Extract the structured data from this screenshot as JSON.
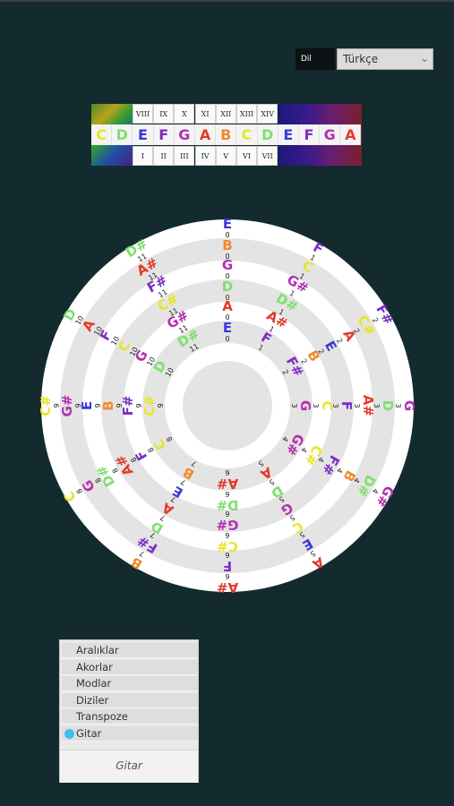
{
  "language": {
    "label": "Dil",
    "selected": "Türkçe"
  },
  "strip": {
    "top_numerals": [
      "VIII",
      "IX",
      "X",
      "XI",
      "XII",
      "XIII",
      "XIV"
    ],
    "bottom_numerals": [
      "I",
      "II",
      "III",
      "IV",
      "V",
      "VI",
      "VII"
    ],
    "notes": [
      {
        "name": "C",
        "color": "#e6e62a"
      },
      {
        "name": "D",
        "color": "#7ee06e"
      },
      {
        "name": "E",
        "color": "#3a3ad6"
      },
      {
        "name": "F",
        "color": "#7b2fc2"
      },
      {
        "name": "G",
        "color": "#b32fb0"
      },
      {
        "name": "A",
        "color": "#e23a2a"
      },
      {
        "name": "B",
        "color": "#f08a2a"
      },
      {
        "name": "C",
        "color": "#e6e62a"
      },
      {
        "name": "D",
        "color": "#7ee06e"
      },
      {
        "name": "E",
        "color": "#3a3ad6"
      },
      {
        "name": "F",
        "color": "#7b2fc2"
      },
      {
        "name": "G",
        "color": "#b32fb0"
      },
      {
        "name": "A",
        "color": "#e23a2a"
      }
    ]
  },
  "wheel": {
    "colors": {
      "C": "#e6e62a",
      "D": "#7ee06e",
      "E": "#3a3ad6",
      "F": "#7b2fc2",
      "G": "#b32fb0",
      "A": "#e23a2a",
      "B": "#f08a2a"
    },
    "frets": [
      "0",
      "1",
      "2",
      "3",
      "4",
      "5",
      "6",
      "7",
      "8",
      "9",
      "10",
      "11"
    ],
    "strings": [
      [
        "E",
        "F",
        "F#",
        "G",
        "G#",
        "A",
        "A#",
        "B",
        "C",
        "C#",
        "D",
        "D#"
      ],
      [
        "B",
        "C",
        "C#",
        "D",
        "D#",
        "E",
        "F",
        "F#",
        "G",
        "G#",
        "A",
        "A#"
      ],
      [
        "G",
        "G#",
        "A",
        "A#",
        "B",
        "C",
        "C#",
        "D",
        "D#",
        "E",
        "F",
        "F#"
      ],
      [
        "D",
        "D#",
        "E",
        "F",
        "F#",
        "G",
        "G#",
        "A",
        "A#",
        "B",
        "C",
        "C#"
      ],
      [
        "A",
        "A#",
        "B",
        "C",
        "C#",
        "D",
        "D#",
        "E",
        "F",
        "F#",
        "G",
        "G#"
      ],
      [
        "E",
        "F",
        "F#",
        "G",
        "G#",
        "A",
        "A#",
        "B",
        "C",
        "C#",
        "D",
        "D#"
      ]
    ]
  },
  "menu": {
    "items": [
      "Aralıklar",
      "Akorlar",
      "Modlar",
      "Diziler",
      "Transpoze",
      "Gitar"
    ],
    "selected": "Gitar",
    "footer": "Gitar"
  }
}
